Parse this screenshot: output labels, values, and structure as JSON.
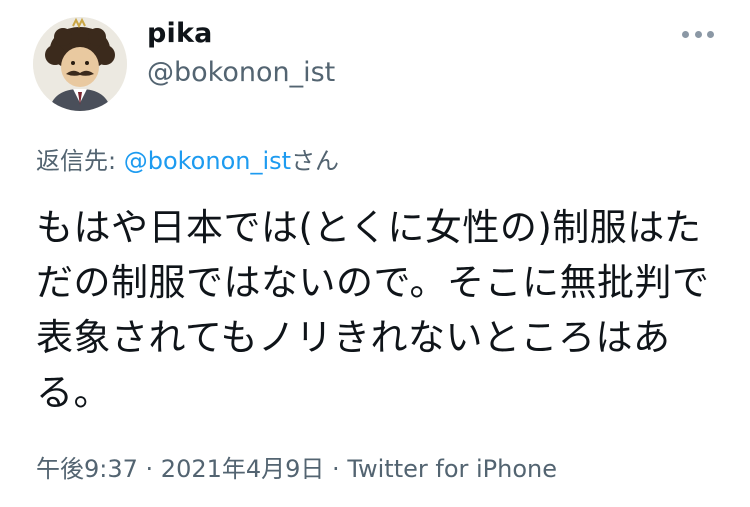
{
  "author": {
    "display_name": "pika",
    "handle": "@bokonon_ist",
    "avatar_icon": "caricature-avatar"
  },
  "more_icon": "more-options-icon",
  "reply": {
    "prefix": "返信先: ",
    "mention": "@bokonon_ist",
    "suffix": "さん"
  },
  "tweet": {
    "text": "もはや日本では(とくに女性の)制服はただの制服ではないので。そこに無批判で表象されてもノリきれないところはある。"
  },
  "meta": {
    "time": "午後9:37",
    "sep1": " · ",
    "date": "2021年4月9日",
    "sep2": " · ",
    "source": "Twitter for iPhone"
  },
  "colors": {
    "link": "#1d9bf0",
    "secondary": "#536471",
    "text": "#0f1419"
  }
}
